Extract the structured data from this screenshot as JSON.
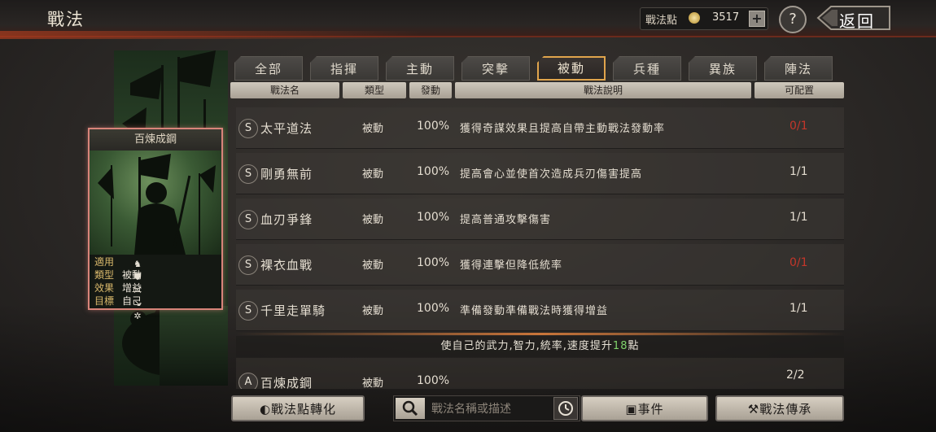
{
  "header": {
    "title": "戰法",
    "points_label": "戰法點",
    "points_value": "3517",
    "plus_label": "+",
    "help_label": "?",
    "back_label": "返回"
  },
  "card": {
    "title": "百煉成鋼",
    "rows": [
      {
        "key": "適用",
        "value": ""
      },
      {
        "key": "類型",
        "value": "被動"
      },
      {
        "key": "效果",
        "value": "增益"
      },
      {
        "key": "目標",
        "value": "自己"
      }
    ],
    "unit_icons": [
      "cavalry-icon",
      "shield-icon",
      "archer-icon",
      "spear-icon",
      "wheel-icon"
    ]
  },
  "tabs": [
    "全部",
    "指揮",
    "主動",
    "突擊",
    "被動",
    "兵種",
    "異族",
    "陣法"
  ],
  "active_tab": 4,
  "columns": [
    "戰法名",
    "類型",
    "發動",
    "戰法說明",
    "可配置"
  ],
  "tactics": [
    {
      "grade": "S",
      "name": "太平道法",
      "type": "被動",
      "rate": "100%",
      "desc": "獲得奇謀效果且提高自帶主動戰法發動率",
      "count": "0/1",
      "count_color": "red"
    },
    {
      "grade": "S",
      "name": "剛勇無前",
      "type": "被動",
      "rate": "100%",
      "desc": "提高會心並使首次造成兵刃傷害提高",
      "count": "1/1",
      "count_color": "normal"
    },
    {
      "grade": "S",
      "name": "血刃爭鋒",
      "type": "被動",
      "rate": "100%",
      "desc": "提高普通攻擊傷害",
      "count": "1/1",
      "count_color": "normal"
    },
    {
      "grade": "S",
      "name": "裸衣血戰",
      "type": "被動",
      "rate": "100%",
      "desc": "獲得連擊但降低統率",
      "count": "0/1",
      "count_color": "red"
    },
    {
      "grade": "S",
      "name": "千里走單騎",
      "type": "被動",
      "rate": "100%",
      "desc": "準備發動準備戰法時獲得增益",
      "count": "1/1",
      "count_color": "normal"
    }
  ],
  "selected": {
    "desc_before": "使自己的武力,智力,統率,速度提升",
    "desc_number": "18",
    "desc_after": "點",
    "grade": "A",
    "name": "百煉成鋼",
    "type": "被動",
    "rate": "100%",
    "count": "2/2"
  },
  "toolbar": {
    "convert_label": "戰法點轉化",
    "search_placeholder": "戰法名稱或描述",
    "events_label": "事件",
    "inherit_label": "戰法傳承"
  }
}
